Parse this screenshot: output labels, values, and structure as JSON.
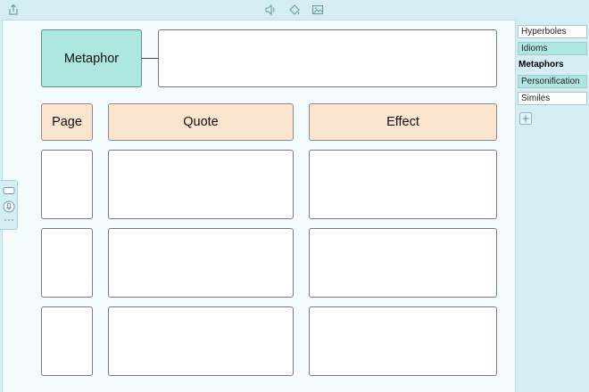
{
  "toolbar": {
    "share_icon": "share-icon",
    "audio_icon": "speaker-icon",
    "fill_icon": "fill-color-icon",
    "image_icon": "image-icon"
  },
  "diagram": {
    "concept_label": "Metaphor",
    "headers": {
      "page": "Page",
      "quote": "Quote",
      "effect": "Effect"
    }
  },
  "tabs": [
    {
      "label": "Hyperboles",
      "state": "normal"
    },
    {
      "label": "Idioms",
      "state": "highlighted"
    },
    {
      "label": "Metaphors",
      "state": "active"
    },
    {
      "label": "Personification",
      "state": "highlighted"
    },
    {
      "label": "Similes",
      "state": "normal"
    }
  ],
  "add_tab_icon": "plus-icon",
  "colors": {
    "background": "#d4eef4",
    "concept_fill": "#aee6e0",
    "header_fill": "#fbe5cf",
    "canvas": "#f4fbfc"
  }
}
